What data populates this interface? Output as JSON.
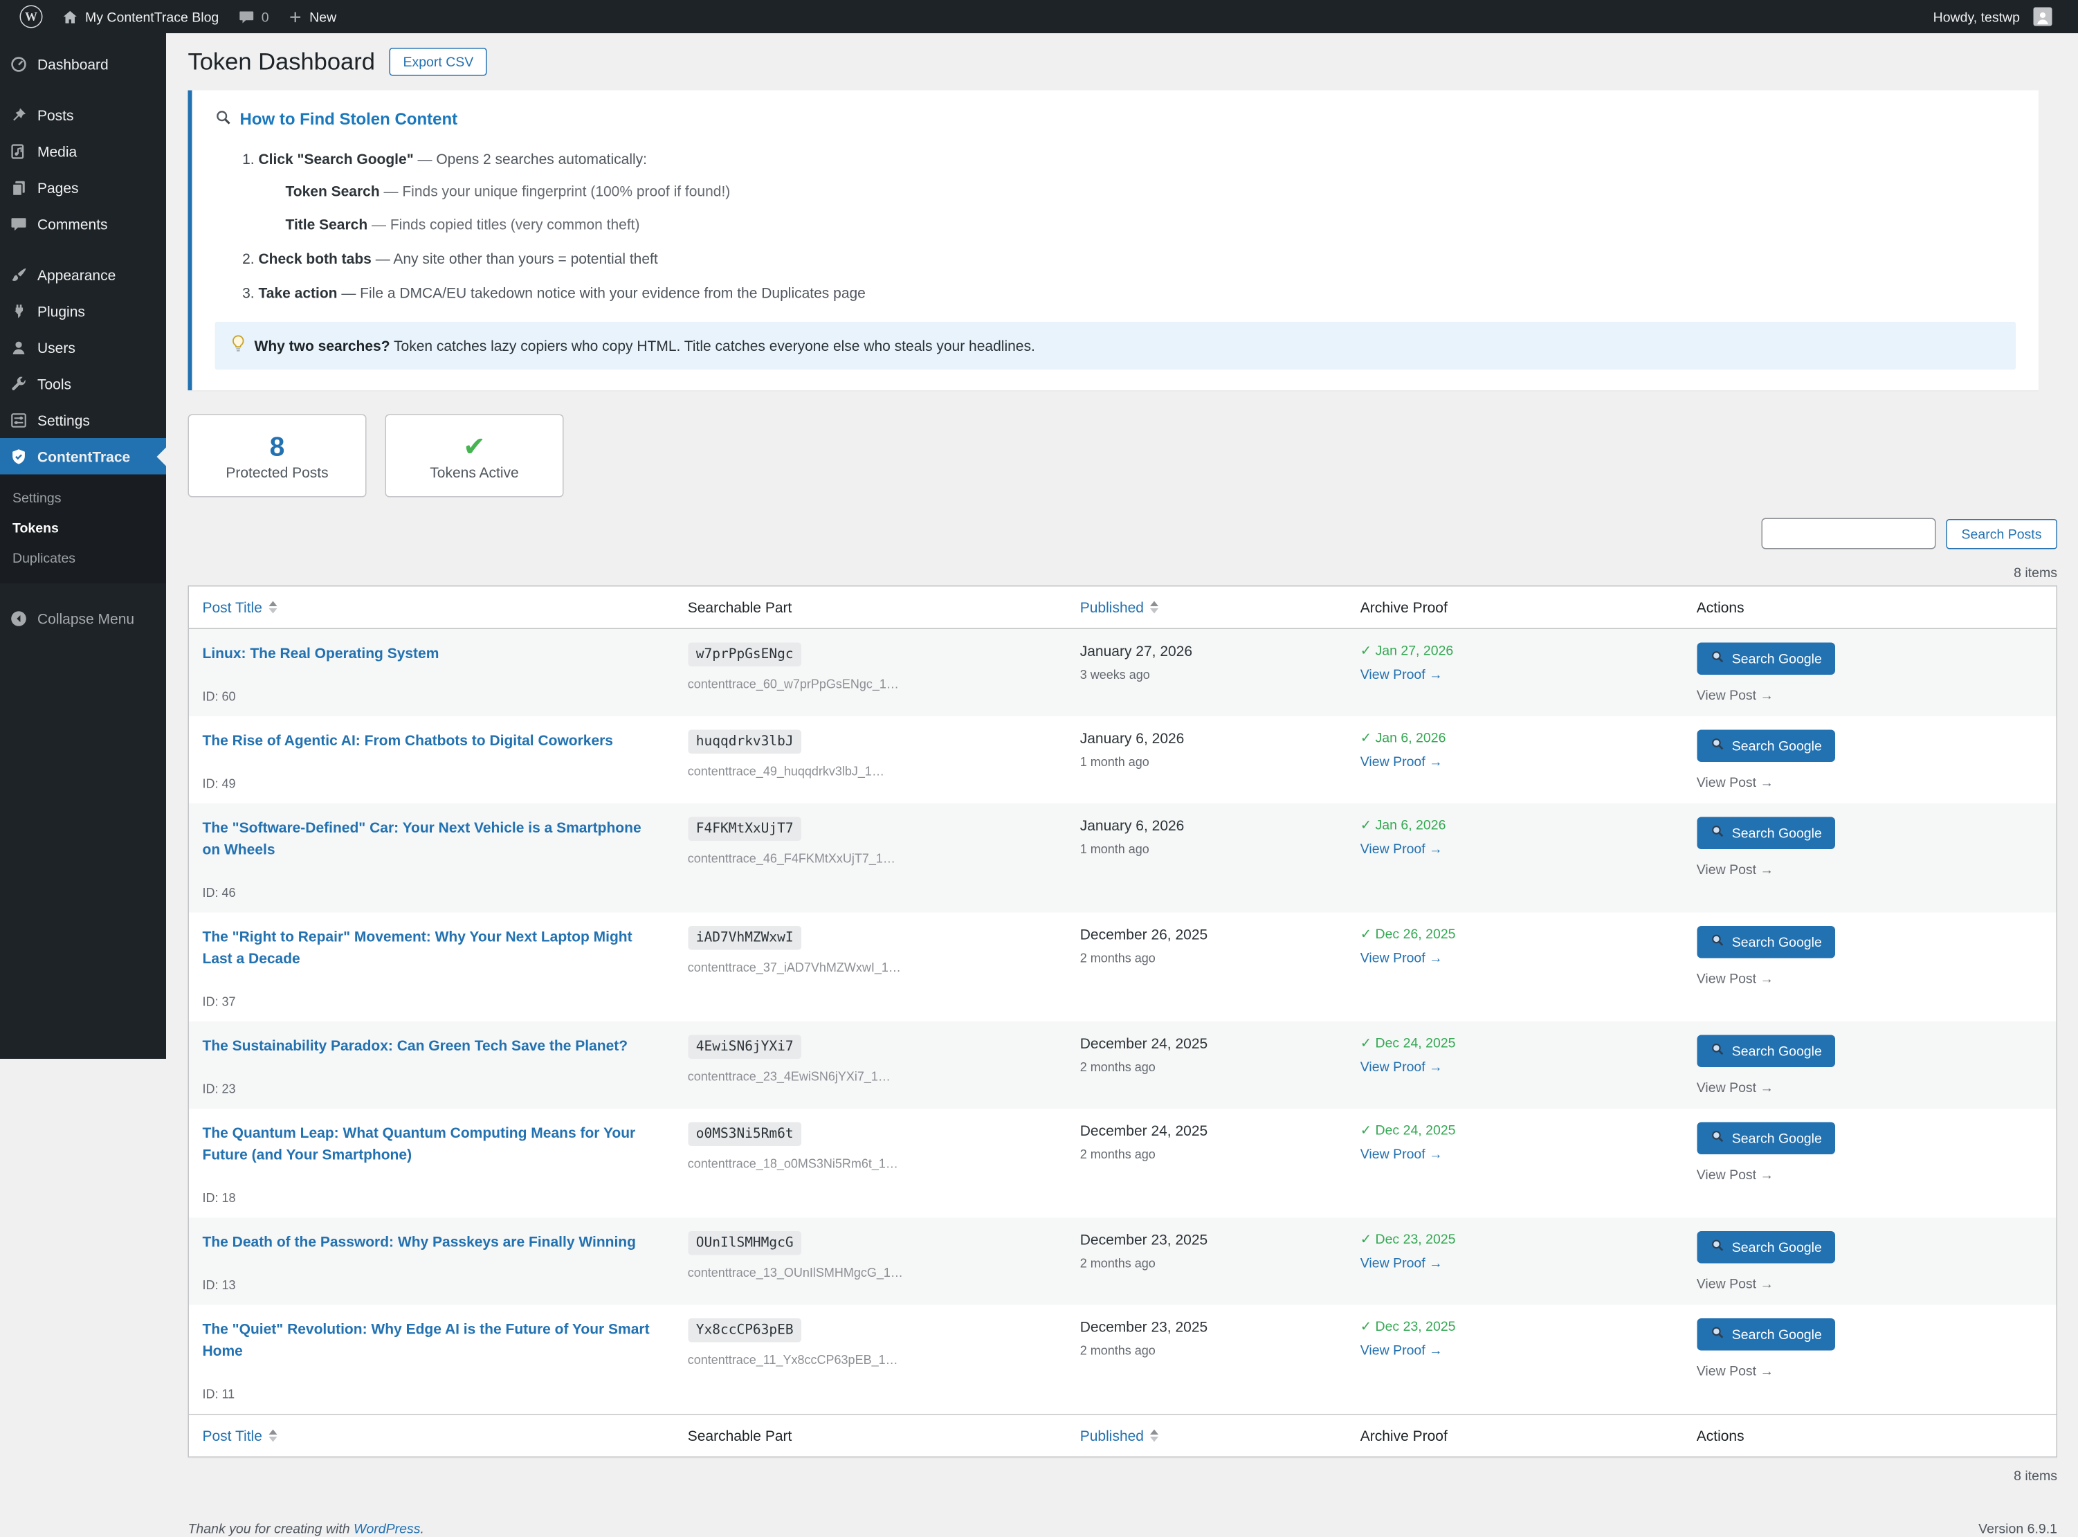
{
  "admin_bar": {
    "logo_letter": "W",
    "site_name": "My ContentTrace Blog",
    "comments_count": "0",
    "new_label": "New",
    "howdy": "Howdy, testwp"
  },
  "sidebar": {
    "items": [
      {
        "label": "Dashboard"
      },
      {
        "label": "Posts"
      },
      {
        "label": "Media"
      },
      {
        "label": "Pages"
      },
      {
        "label": "Comments"
      },
      {
        "label": "Appearance"
      },
      {
        "label": "Plugins"
      },
      {
        "label": "Users"
      },
      {
        "label": "Tools"
      },
      {
        "label": "Settings"
      },
      {
        "label": "ContentTrace"
      }
    ],
    "submenu": [
      {
        "label": "Settings"
      },
      {
        "label": "Tokens",
        "current": true
      },
      {
        "label": "Duplicates"
      }
    ],
    "collapse_label": "Collapse Menu"
  },
  "page": {
    "title": "Token Dashboard",
    "export_button": "Export CSV"
  },
  "instructions": {
    "title": "How to Find Stolen Content",
    "steps": [
      {
        "bold": "Click \"Search Google\"",
        "rest": " — Opens 2 searches automatically:",
        "sub": [
          {
            "bold": "Token Search",
            "rest": " — Finds your unique fingerprint (100% proof if found!)"
          },
          {
            "bold": "Title Search",
            "rest": " — Finds copied titles (very common theft)"
          }
        ]
      },
      {
        "bold": "Check both tabs",
        "rest": " — Any site other than yours = potential theft"
      },
      {
        "bold": "Take action",
        "rest": " — File a DMCA/EU takedown notice with your evidence from the Duplicates page"
      }
    ],
    "tip_bold": "Why two searches?",
    "tip_rest": " Token catches lazy copiers who copy HTML. Title catches everyone else who steals your headlines."
  },
  "stats": {
    "protected": {
      "value": "8",
      "label": "Protected Posts"
    },
    "active": {
      "check": "✔",
      "label": "Tokens Active"
    }
  },
  "search": {
    "button_label": "Search Posts"
  },
  "table": {
    "items_count": "8 items",
    "headers": {
      "post_title": "Post Title",
      "searchable": "Searchable Part",
      "published": "Published",
      "archive": "Archive Proof",
      "actions": "Actions"
    },
    "labels": {
      "search_google": "Search Google",
      "view_post": "View Post →",
      "view_proof": "View Proof →"
    },
    "rows": [
      {
        "title": "Linux: The Real Operating System",
        "id_label": "ID: 60",
        "token": "w7prPpGsENgc",
        "token_full": "contenttrace_60_w7prPpGsENgc_1…",
        "published": "January 27, 2026",
        "published_rel": "3 weeks ago",
        "archive": "✓ Jan 27, 2026"
      },
      {
        "title": "The Rise of Agentic AI: From Chatbots to Digital Coworkers",
        "id_label": "ID: 49",
        "token": "huqqdrkv3lbJ",
        "token_full": "contenttrace_49_huqqdrkv3lbJ_1…",
        "published": "January 6, 2026",
        "published_rel": "1 month ago",
        "archive": "✓ Jan 6, 2026"
      },
      {
        "title": "The \"Software-Defined\" Car: Your Next Vehicle is a Smartphone on Wheels",
        "id_label": "ID: 46",
        "token": "F4FKMtXxUjT7",
        "token_full": "contenttrace_46_F4FKMtXxUjT7_1…",
        "published": "January 6, 2026",
        "published_rel": "1 month ago",
        "archive": "✓ Jan 6, 2026"
      },
      {
        "title": "The \"Right to Repair\" Movement: Why Your Next Laptop Might Last a Decade",
        "id_label": "ID: 37",
        "token": "iAD7VhMZWxwI",
        "token_full": "contenttrace_37_iAD7VhMZWxwI_1…",
        "published": "December 26, 2025",
        "published_rel": "2 months ago",
        "archive": "✓ Dec 26, 2025"
      },
      {
        "title": "The Sustainability Paradox: Can Green Tech Save the Planet?",
        "id_label": "ID: 23",
        "token": "4EwiSN6jYXi7",
        "token_full": "contenttrace_23_4EwiSN6jYXi7_1…",
        "published": "December 24, 2025",
        "published_rel": "2 months ago",
        "archive": "✓ Dec 24, 2025"
      },
      {
        "title": "The Quantum Leap: What Quantum Computing Means for Your Future (and Your Smartphone)",
        "id_label": "ID: 18",
        "token": "o0MS3Ni5Rm6t",
        "token_full": "contenttrace_18_o0MS3Ni5Rm6t_1…",
        "published": "December 24, 2025",
        "published_rel": "2 months ago",
        "archive": "✓ Dec 24, 2025"
      },
      {
        "title": "The Death of the Password: Why Passkeys are Finally Winning",
        "id_label": "ID: 13",
        "token": "OUnIlSMHMgcG",
        "token_full": "contenttrace_13_OUnIlSMHMgcG_1…",
        "published": "December 23, 2025",
        "published_rel": "2 months ago",
        "archive": "✓ Dec 23, 2025"
      },
      {
        "title": "The \"Quiet\" Revolution: Why Edge AI is the Future of Your Smart Home",
        "id_label": "ID: 11",
        "token": "Yx8ccCP63pEB",
        "token_full": "contenttrace_11_Yx8ccCP63pEB_1…",
        "published": "December 23, 2025",
        "published_rel": "2 months ago",
        "archive": "✓ Dec 23, 2025"
      }
    ]
  },
  "footer": {
    "thanks_prefix": "Thank you for creating with ",
    "wordpress_link": "WordPress",
    "thanks_suffix": ".",
    "version": "Version 6.9.1"
  }
}
